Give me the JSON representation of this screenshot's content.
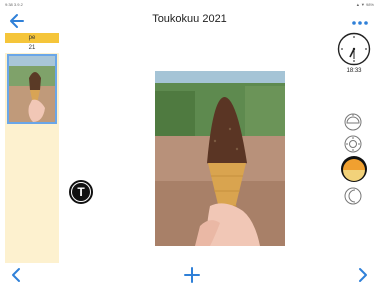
{
  "status": {
    "left": "9:38 3.9.2",
    "right": "▲ ▼ 98%"
  },
  "header": {
    "title": "Toukokuu 2021"
  },
  "sidebar": {
    "day_label": "pe",
    "day_number": "21"
  },
  "main": {
    "photo": "ice-cream-cone-photo"
  },
  "clock": {
    "time": "18:33"
  },
  "time_of_day": [
    "morning-icon",
    "day-icon",
    "evening-icon",
    "night-icon"
  ],
  "timer_button": {
    "letter": "T"
  },
  "colors": {
    "accent": "#2f80d8",
    "sidebar_bg": "#fdf1cf",
    "day_header": "#f5c53a",
    "evening": "#f0a030"
  }
}
